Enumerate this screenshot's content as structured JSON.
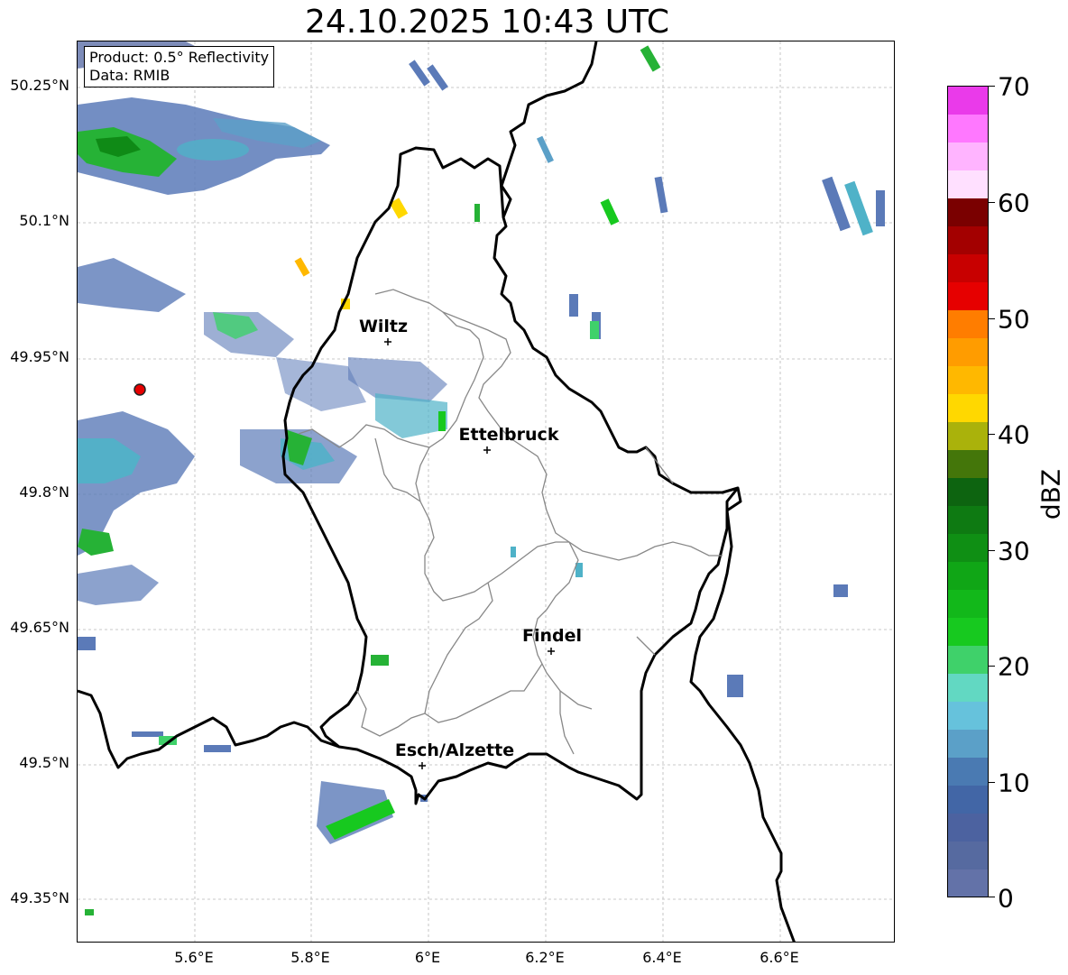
{
  "title": "24.10.2025 10:43 UTC",
  "info_box": {
    "product": "Product: 0.5° Reflectivity",
    "data": "Data: RMIB"
  },
  "lat_ticks": [
    "50.25°N",
    "50.1°N",
    "49.95°N",
    "49.8°N",
    "49.65°N",
    "49.5°N",
    "49.35°N"
  ],
  "lon_ticks": [
    "5.6°E",
    "5.8°E",
    "6°E",
    "6.2°E",
    "6.4°E",
    "6.6°E"
  ],
  "cities": [
    {
      "name": "Wiltz"
    },
    {
      "name": "Ettelbruck"
    },
    {
      "name": "Findel"
    },
    {
      "name": "Esch/Alzette"
    }
  ],
  "colorbar": {
    "label": "dBZ",
    "ticks": [
      "70",
      "60",
      "50",
      "40",
      "30",
      "20",
      "10",
      "0"
    ],
    "colors": [
      "#6372a8",
      "#566aa0",
      "#4c62a0",
      "#4266a6",
      "#4a7ab2",
      "#5ba0c8",
      "#66c2dc",
      "#62d8c2",
      "#3fd16a",
      "#17c91f",
      "#12b81a",
      "#10a616",
      "#0f8f14",
      "#0e7a12",
      "#0d6410",
      "#44760a",
      "#aab20b",
      "#ffd800",
      "#ffb800",
      "#ff9c00",
      "#ff7d00",
      "#e60000",
      "#c80000",
      "#a30000",
      "#7a0000",
      "#ffe0ff",
      "#ffb4ff",
      "#ff78ff",
      "#ea3aea"
    ]
  }
}
